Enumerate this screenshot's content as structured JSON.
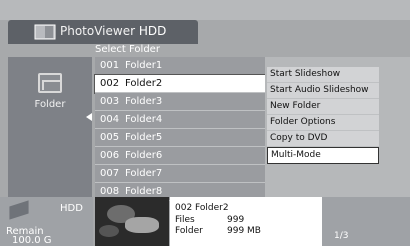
{
  "header": {
    "title_part1": "PhotoViewer",
    "title_part2": "HDD",
    "icon": "photo-viewer-icon"
  },
  "left_panel": {
    "label": "Folder",
    "icon": "folder-icon"
  },
  "list": {
    "header": "Select Folder",
    "rows": [
      {
        "num": "001",
        "name": "Folder1"
      },
      {
        "num": "002",
        "name": "Folder2"
      },
      {
        "num": "003",
        "name": "Folder3"
      },
      {
        "num": "004",
        "name": "Folder4"
      },
      {
        "num": "005",
        "name": "Folder5"
      },
      {
        "num": "006",
        "name": "Folder6"
      },
      {
        "num": "007",
        "name": "Folder7"
      },
      {
        "num": "008",
        "name": "Folder8"
      }
    ],
    "selected_index": 1
  },
  "menu": {
    "items": [
      "Start Slideshow",
      "Start Audio Slideshow",
      "New Folder",
      "Folder Options",
      "Copy to DVD",
      "Multi-Mode"
    ],
    "selected_index": 5
  },
  "bottom": {
    "hdd_label": "HDD",
    "remain_label": "Remain",
    "remain_value": "100.0 G",
    "info_title": "002  Folder2",
    "files_label": "Files",
    "files_value": "999",
    "folder_label": "Folder",
    "folder_value": "999 MB",
    "page": "1/3"
  }
}
